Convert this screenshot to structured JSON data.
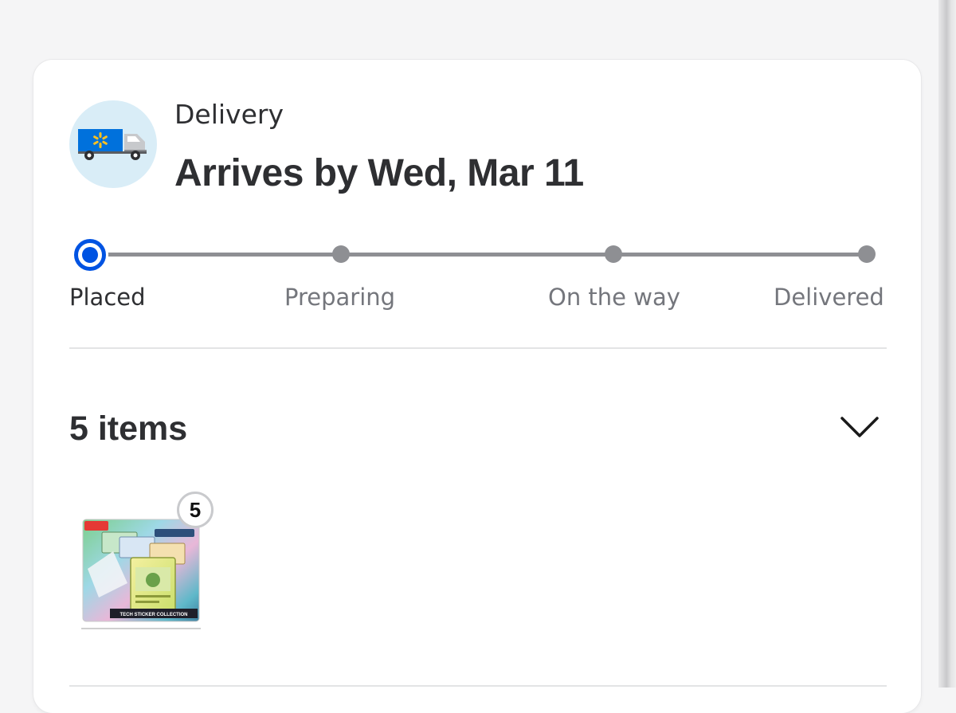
{
  "delivery": {
    "icon": "delivery-truck-icon",
    "label": "Delivery",
    "arrives": "Arrives by Wed, Mar 11"
  },
  "progress": {
    "active_step": 0,
    "steps": [
      {
        "label": "Placed"
      },
      {
        "label": "Preparing"
      },
      {
        "label": "On the way"
      },
      {
        "label": "Delivered"
      }
    ]
  },
  "items": {
    "count_label": "5 items",
    "toggle_icon": "chevron-down-icon",
    "products": [
      {
        "image_icon": "product-thumbnail",
        "quantity": "5",
        "package_text": "TECH STICKER COLLECTION"
      }
    ]
  },
  "colors": {
    "accent": "#0053e2",
    "truck_bg": "#d9edf7",
    "track": "#8e8f93",
    "text": "#2e2f32",
    "muted": "#74767c"
  }
}
